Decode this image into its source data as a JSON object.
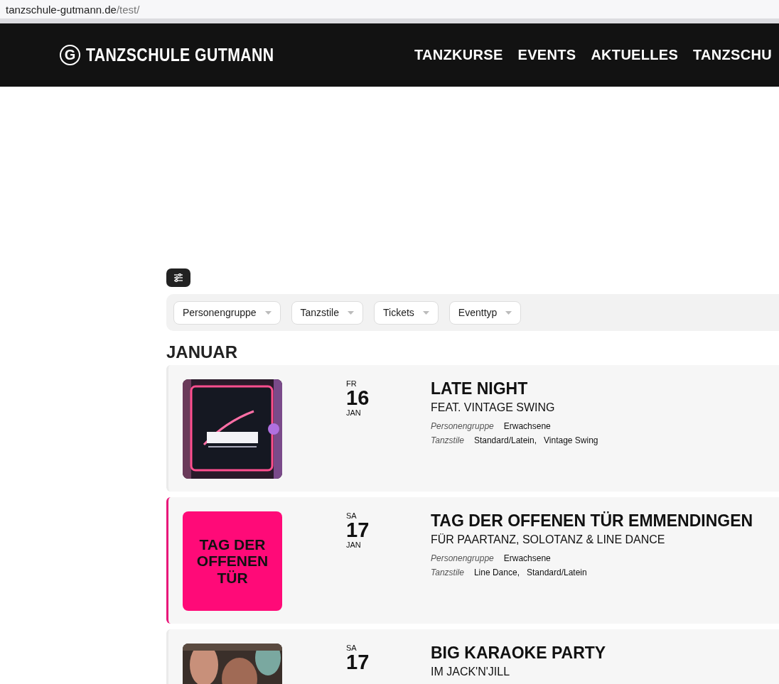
{
  "address_bar": {
    "domain": "tanzschule-gutmann.de",
    "path": "/test/"
  },
  "header": {
    "logo_letter": "G",
    "logo_text": "TANZSCHULE GUTMANN",
    "nav": [
      "TANZKURSE",
      "EVENTS",
      "AKTUELLES",
      "TANZSCHU"
    ]
  },
  "filters": [
    {
      "label": "Personengruppe"
    },
    {
      "label": "Tanzstile"
    },
    {
      "label": "Tickets"
    },
    {
      "label": "Eventtyp"
    }
  ],
  "month": "JANUAR",
  "events": [
    {
      "image": {
        "kind": "picture"
      },
      "weekday": "FR",
      "day": "16",
      "month": "JAN",
      "title": "LATE NIGHT",
      "subtitle": "FEAT. VINTAGE SWING",
      "highlighted": false,
      "meta": [
        {
          "label": "Personengruppe",
          "values": [
            "Erwachsene"
          ]
        },
        {
          "label": "Tanzstile",
          "values": [
            "Standard/Latein,",
            "Vintage Swing"
          ]
        }
      ]
    },
    {
      "image": {
        "kind": "text-tile",
        "text": "TAG DER OFFENEN TÜR"
      },
      "weekday": "SA",
      "day": "17",
      "month": "JAN",
      "title": "TAG DER OFFENEN TÜR EMMENDINGEN",
      "subtitle": "FÜR PAARTANZ, SOLOTANZ & LINE DANCE",
      "highlighted": true,
      "meta": [
        {
          "label": "Personengruppe",
          "values": [
            "Erwachsene"
          ]
        },
        {
          "label": "Tanzstile",
          "values": [
            "Line Dance,",
            "Standard/Latein"
          ]
        }
      ]
    },
    {
      "image": {
        "kind": "picture"
      },
      "weekday": "SA",
      "day": "17",
      "title": "BIG KARAOKE PARTY",
      "subtitle": "IM JACK'N'JILL",
      "highlighted": false
    }
  ]
}
